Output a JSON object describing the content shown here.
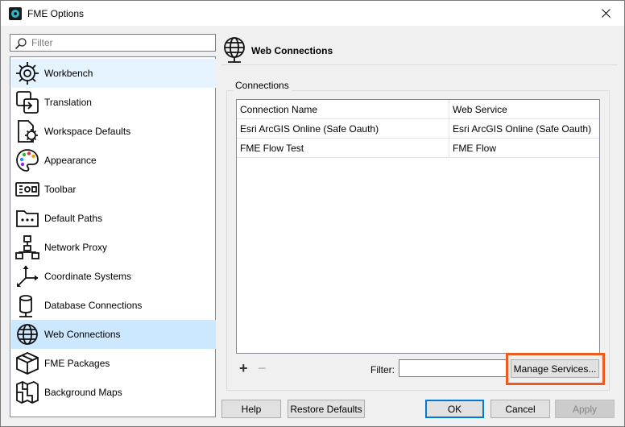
{
  "window": {
    "title": "FME Options"
  },
  "sidebar": {
    "filter_placeholder": "Filter",
    "items": [
      {
        "label": "Workbench",
        "icon": "workbench-icon"
      },
      {
        "label": "Translation",
        "icon": "translation-icon"
      },
      {
        "label": "Workspace Defaults",
        "icon": "workspace-defaults-icon"
      },
      {
        "label": "Appearance",
        "icon": "palette-icon"
      },
      {
        "label": "Toolbar",
        "icon": "toolbar-icon"
      },
      {
        "label": "Default Paths",
        "icon": "folder-icon"
      },
      {
        "label": "Network Proxy",
        "icon": "network-icon"
      },
      {
        "label": "Coordinate Systems",
        "icon": "axes-icon"
      },
      {
        "label": "Database Connections",
        "icon": "database-icon"
      },
      {
        "label": "Web Connections",
        "icon": "globe-icon"
      },
      {
        "label": "FME Packages",
        "icon": "package-icon"
      },
      {
        "label": "Background Maps",
        "icon": "map-icon"
      }
    ],
    "selected": "Web Connections"
  },
  "main": {
    "title": "Web Connections",
    "group_label": "Connections",
    "table": {
      "headers": [
        "Connection Name",
        "Web Service"
      ],
      "rows": [
        [
          "Esri ArcGIS Online (Safe Oauth)",
          "Esri ArcGIS Online (Safe Oauth)"
        ],
        [
          "FME Flow Test",
          "FME Flow"
        ]
      ]
    },
    "add_label": "+",
    "remove_label": "−",
    "filter_label": "Filter:",
    "filter_value": "",
    "manage_services_label": "Manage Services..."
  },
  "footer": {
    "help": "Help",
    "restore_defaults": "Restore Defaults",
    "ok": "OK",
    "cancel": "Cancel",
    "apply": "Apply"
  },
  "colors": {
    "selected_bg": "#cce8ff",
    "highlight_border": "#f05a1e"
  }
}
